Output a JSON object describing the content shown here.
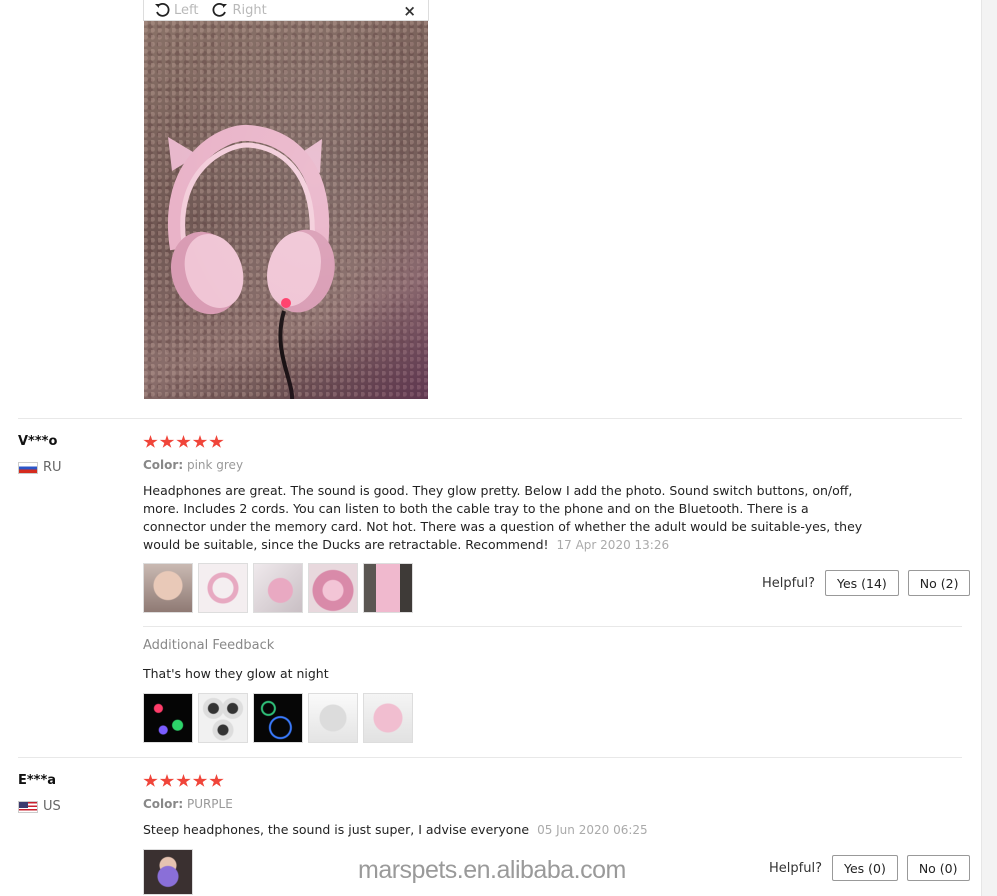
{
  "viewer": {
    "rotate_left_label": "Left",
    "rotate_right_label": "Right",
    "close_label": "×"
  },
  "reviews": [
    {
      "name": "V***o",
      "country": "RU",
      "stars": 5,
      "color_label": "Color:",
      "color_value": "pink grey",
      "text": "Headphones are great. The sound is good. They glow pretty. Below I add the photo. Sound switch buttons, on/off, more. Includes 2 cords. You can listen to both the cable tray to the phone and on the Bluetooth. There is a connector under the memory card. Not hot. There was a question of whether the adult would be suitable-yes, they would be suitable, since the Ducks are retractable. Recommend!",
      "date": "17 Apr 2020 13:26",
      "helpful_label": "Helpful?",
      "yes_label": "Yes (14)",
      "no_label": "No (2)",
      "additional": {
        "title": "Additional Feedback",
        "text": "That's how they glow at night"
      }
    },
    {
      "name": "E***a",
      "country": "US",
      "stars": 5,
      "color_label": "Color:",
      "color_value": "PURPLE",
      "text": "Steep headphones, the sound is just super, I advise everyone",
      "date": "05 Jun 2020 06:25",
      "helpful_label": "Helpful?",
      "yes_label": "Yes (0)",
      "no_label": "No (0)"
    }
  ],
  "watermark": "marspets.en.alibaba.com",
  "colors": {
    "star": "#f0453a",
    "muted": "#999999"
  }
}
